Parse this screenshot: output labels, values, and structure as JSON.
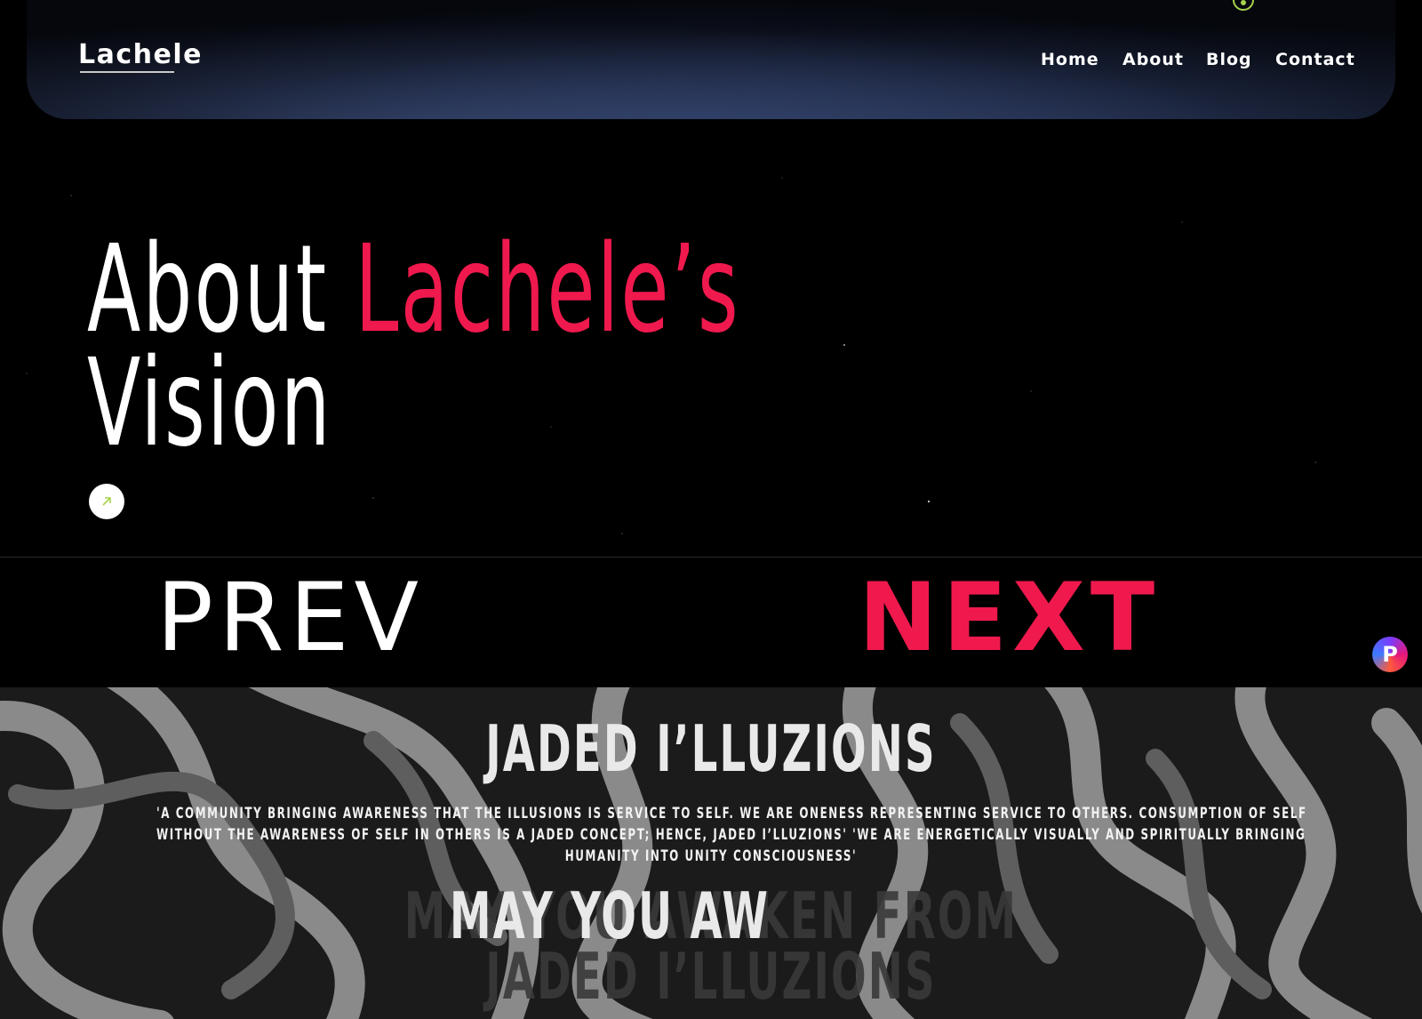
{
  "nav": {
    "logo": "Lachele",
    "links": [
      "Home",
      "About",
      "Blog",
      "Contact"
    ]
  },
  "hero": {
    "title_white": "About",
    "title_accent": "Lachele’s",
    "title_line2": "Vision",
    "button_icon": "arrow-up-right-icon"
  },
  "pager": {
    "prev": "PREV",
    "next": "NEXT"
  },
  "about": {
    "title": "JADED I’LLUZIONS",
    "paragraph_lines": [
      "'A COMMUNITY BRINGING AWARENESS THAT THE ILLUSIONS IS SERVICE TO SELF. WE ARE ONENESS REPRESENTING SERVICE TO OTHERS. CONSUMPTION OF SELF",
      "WITHOUT THE AWARENESS OF SELF IN OTHERS IS A JADED CONCEPT; HENCE, JADED I’LLUZIONS' 'WE ARE ENERGETICALLY VISUALLY AND SPIRITUALLY BRINGING",
      "HUMANITY INTO UNITY CONSCIOUSNESS'"
    ],
    "typing_text": "MAY YOU AW",
    "ghost_line1": "MAY YOU AWAKEN FROM",
    "ghost_line2": "JADED I’LLUZIONS"
  },
  "colors": {
    "accent": "#f0194d",
    "cursor": "#a6d34a"
  }
}
